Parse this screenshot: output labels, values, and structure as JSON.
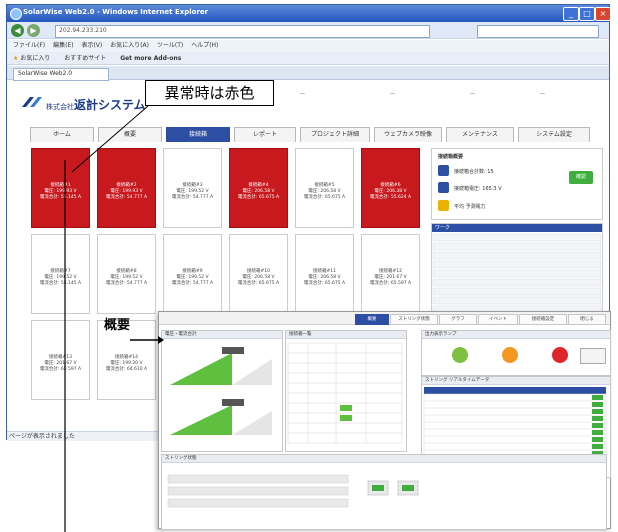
{
  "browser": {
    "title": "SolarWise Web2.0 - Windows Internet Explorer",
    "address": "202.94.233.210",
    "menu": [
      "ファイル(F)",
      "編集(E)",
      "表示(V)",
      "お気に入り(A)",
      "ツール(T)",
      "ヘルプ(H)"
    ],
    "favorites": [
      "お気に入り",
      "おすすめサイト",
      "Get more Add-ons"
    ],
    "tab": "SolarWise Web2.0",
    "status_text": "ページが表示されました"
  },
  "page": {
    "company": "株式会社",
    "company_name": "返計システム",
    "tabs": [
      "ホーム",
      "概要",
      "接続箱",
      "レポート",
      "プロジェクト詳細",
      "ウェブカメラ映像",
      "メンテナンス",
      "システム設定"
    ],
    "active_tab_index": 2,
    "cards_row1": [
      {
        "name": "接続箱#1",
        "v": "電圧: 199.93 V",
        "a": "電流合計: 55.145 A",
        "alarm": true
      },
      {
        "name": "接続箱#2",
        "v": "電圧: 199.93 V",
        "a": "電流合計: 54.777 A",
        "alarm": true
      },
      {
        "name": "接続箱#3",
        "v": "電圧: 199.52 V",
        "a": "電流合計: 54.777 A",
        "alarm": false
      },
      {
        "name": "接続箱#4",
        "v": "電圧: 206.58 V",
        "a": "電流合計: 65.675 A",
        "alarm": true
      },
      {
        "name": "接続箱#5",
        "v": "電圧: 206.58 V",
        "a": "電流合計: 65.675 A",
        "alarm": false
      },
      {
        "name": "接続箱#6",
        "v": "電圧: 206.38 V",
        "a": "電流合計: 55.624 A",
        "alarm": true
      }
    ],
    "cards_row2": [
      {
        "name": "接続箱#7",
        "v": "電圧: 199.52 V",
        "a": "電流合計: 55.145 A"
      },
      {
        "name": "接続箱#8",
        "v": "電圧: 199.52 V",
        "a": "電流合計: 54.777 A"
      },
      {
        "name": "接続箱#9",
        "v": "電圧: 199.52 V",
        "a": "電流合計: 54.777 A"
      },
      {
        "name": "接続箱#10",
        "v": "電圧: 206.58 V",
        "a": "電流合計: 65.675 A"
      },
      {
        "name": "接続箱#11",
        "v": "電圧: 206.58 V",
        "a": "電流合計: 65.675 A"
      },
      {
        "name": "接続箱#12",
        "v": "電圧: 201.67 V",
        "a": "電流合計: 65.597 A"
      }
    ],
    "cards_row3": [
      {
        "name": "接続箱#13",
        "v": "電圧: 201.67 V",
        "a": "電流合計: 65.597 A"
      },
      {
        "name": "接続箱#14",
        "v": "電圧: 199.20 V",
        "a": "電流合計: 64.610 A"
      }
    ],
    "status_title": "接続箱概要",
    "status_lines": [
      "接続箱合計数: 15",
      "接続箱電圧: 165.3 V",
      "平均 予測電力"
    ],
    "status_button": "確認",
    "list_header": "ワーク"
  },
  "overlay": {
    "tabs": [
      "概要",
      "ストリング状態",
      "グラフ",
      "イベント",
      "接続箱設定",
      "閉じる"
    ],
    "active_tab_index": 0,
    "box1_title": "電圧・電流合計",
    "box2_title": "接続箱一覧",
    "box3_title": "出力表示ランプ",
    "box4_title": "ストリング リアルタイムデータ",
    "box5_title": "ストリング状態"
  },
  "annotations": {
    "callout": "異常時は赤色",
    "overview_label": "概要"
  },
  "colors": {
    "alarm": "#c8191e",
    "accent": "#2c4fa3"
  }
}
